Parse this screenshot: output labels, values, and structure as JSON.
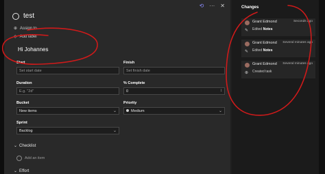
{
  "task": {
    "title": "test",
    "assign_label": "Assign to",
    "label_label": "Add label",
    "notes": "Hi Johannes"
  },
  "fields": {
    "start_label": "Start",
    "start_placeholder": "Set start date",
    "finish_label": "Finish",
    "finish_placeholder": "Set finish date",
    "duration_label": "Duration",
    "duration_placeholder": "E.g. \"2d\"",
    "percent_label": "% Complete",
    "percent_value": "0",
    "bucket_label": "Bucket",
    "bucket_value": "New items",
    "priority_label": "Priority",
    "priority_value": "Medium",
    "sprint_label": "Sprint",
    "sprint_value": "Backlog"
  },
  "sections": {
    "checklist": "Checklist",
    "add_item": "Add an item",
    "effort": "Effort"
  },
  "changes": {
    "title": "Changes",
    "items": [
      {
        "user": "Grant Edmond",
        "time": "Seconds ago",
        "action": "Edited",
        "target": "Notes"
      },
      {
        "user": "Grant Edmond",
        "time": "Several minutes ago",
        "action": "Edited",
        "target": "Notes"
      },
      {
        "user": "Grant Edmond",
        "time": "Several minutes ago",
        "action": "Created task",
        "target": ""
      }
    ]
  },
  "colors": {
    "annotation": "#d01a1a",
    "history_icon": "#8c8cff"
  },
  "icons": {
    "history": "history-icon",
    "more": "more-icon",
    "close": "close-icon",
    "assign": "person-add-icon",
    "label": "tag-icon"
  }
}
